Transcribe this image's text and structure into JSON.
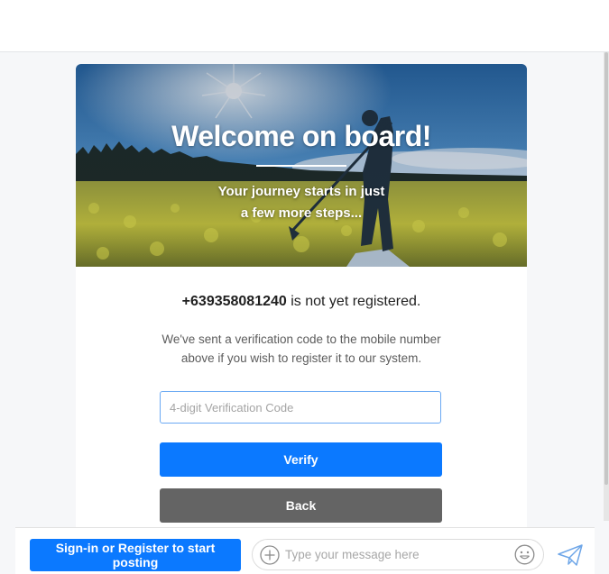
{
  "hero": {
    "title": "Welcome on board!",
    "subtitle_line1": "Your journey starts in just",
    "subtitle_line2": "a few more steps..."
  },
  "registration": {
    "phone_number": "+639358081240",
    "status_text": " is not yet registered.",
    "description_line1": "We've sent a verification code to the mobile number",
    "description_line2": "above if you wish to register it to our system."
  },
  "form": {
    "code_placeholder": "4-digit Verification Code",
    "code_value": "",
    "verify_label": "Verify",
    "back_label": "Back"
  },
  "chatbar": {
    "signin_label": "Sign-in or Register to start posting",
    "message_placeholder": "Type your message here",
    "icons": [
      "plus-icon",
      "emoji-icon",
      "send-icon"
    ]
  },
  "colors": {
    "primary": "#0b79ff",
    "back_button": "#646464",
    "page_background": "#f6f7f9"
  }
}
